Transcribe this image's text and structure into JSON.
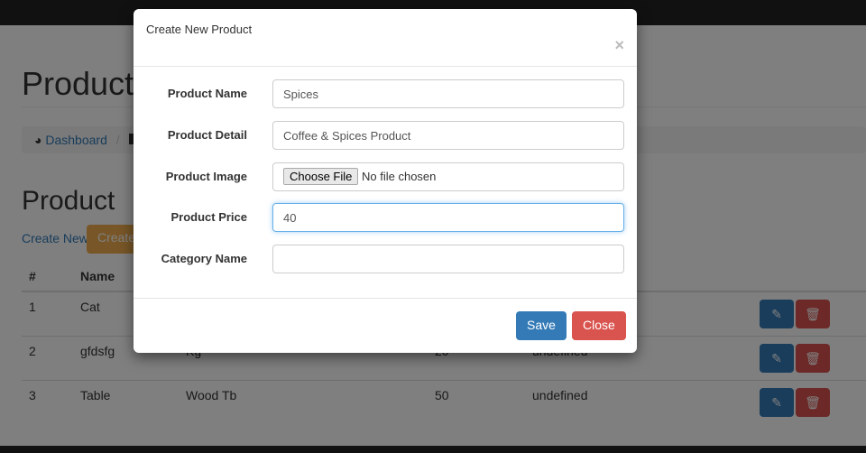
{
  "page": {
    "title": "Product",
    "section_title": "Product",
    "create_new_link": "Create New",
    "create_button": "Create",
    "breadcrumb": [
      {
        "label": "Dashboard",
        "icon": "dashboard-icon"
      }
    ],
    "breadcrumb_sep": "/"
  },
  "table": {
    "headers": [
      "#",
      "Name"
    ],
    "rows": [
      {
        "num": "1",
        "name": "Cat",
        "detail": "",
        "price": "",
        "category": ""
      },
      {
        "num": "2",
        "name": "gfdsfg",
        "detail": "Kg",
        "price": "20",
        "category": "undefined"
      },
      {
        "num": "3",
        "name": "Table",
        "detail": "Wood Tb",
        "price": "50",
        "category": "undefined"
      }
    ]
  },
  "modal": {
    "title": "Create New Product",
    "close_x": "×",
    "fields": [
      {
        "label": "Product Name",
        "value": "Spices"
      },
      {
        "label": "Product Detail",
        "value": "Coffee & Spices Product"
      },
      {
        "label": "Product Image",
        "file_button": "Choose File",
        "file_status": "No file chosen"
      },
      {
        "label": "Product Price",
        "value": "40"
      },
      {
        "label": "Category Name",
        "value": ""
      }
    ],
    "save": "Save",
    "close": "Close"
  },
  "colors": {
    "primary": "#337ab7",
    "danger": "#d9534f",
    "warning": "#f0ad4e"
  }
}
